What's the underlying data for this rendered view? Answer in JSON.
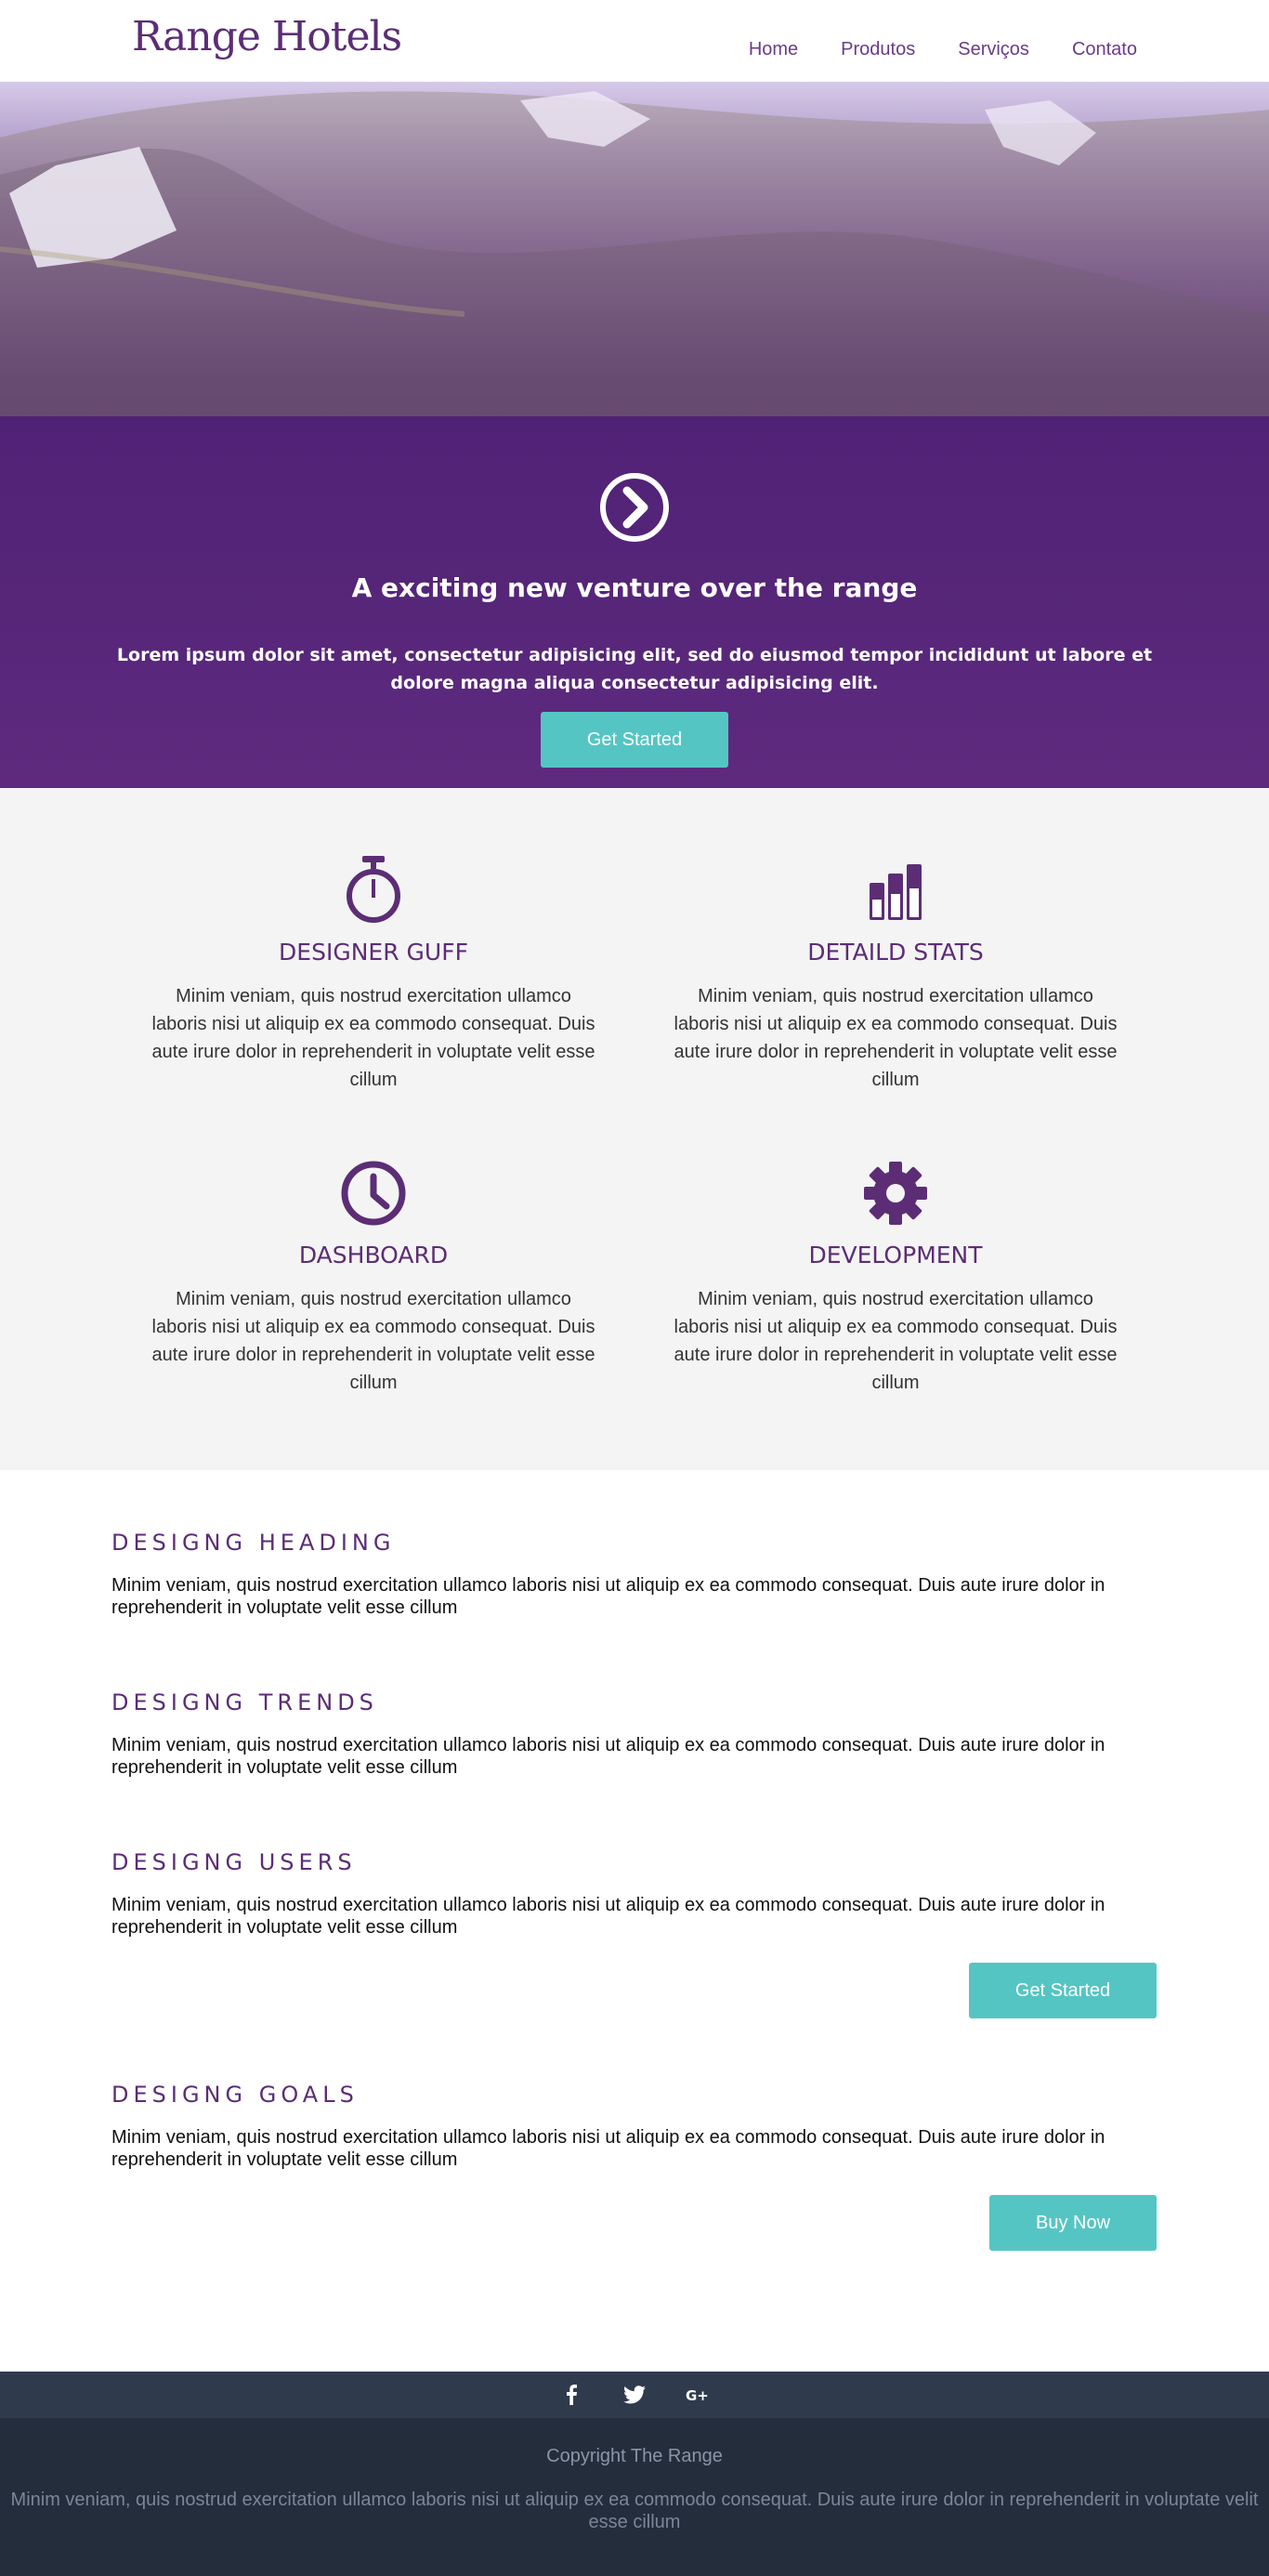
{
  "header": {
    "logo": "Range Hotels",
    "nav": [
      "Home",
      "Produtos",
      "Serviços",
      "Contato"
    ]
  },
  "hero": {
    "icon": "chevron-circle-right-icon",
    "title": "A exciting new venture over the range",
    "text": "Lorem ipsum dolor sit amet, consectetur adipisicing elit, sed do eiusmod tempor incididunt ut labore et dolore magna aliqua consectetur adipisicing elit.",
    "button": "Get Started"
  },
  "features": [
    {
      "icon": "stopwatch-icon",
      "title": "DESIGNER GUFF",
      "text": "Minim veniam, quis nostrud exercitation ullamco laboris nisi ut aliquip ex ea commodo consequat. Duis aute irure dolor in reprehenderit in voluptate velit esse cillum"
    },
    {
      "icon": "bar-chart-icon",
      "title": "DETAILD STATS",
      "text": "Minim veniam, quis nostrud exercitation ullamco laboris nisi ut aliquip ex ea commodo consequat. Duis aute irure dolor in reprehenderit in voluptate velit esse cillum"
    },
    {
      "icon": "clock-icon",
      "title": "DASHBOARD",
      "text": "Minim veniam, quis nostrud exercitation ullamco laboris nisi ut aliquip ex ea commodo consequat. Duis aute irure dolor in reprehenderit in voluptate velit esse cillum"
    },
    {
      "icon": "gear-icon",
      "title": "DEVELOPMENT",
      "text": "Minim veniam, quis nostrud exercitation ullamco laboris nisi ut aliquip ex ea commodo consequat. Duis aute irure dolor in reprehenderit in voluptate velit esse cillum"
    }
  ],
  "sections": [
    {
      "heading": "DESIGNG HEADING",
      "text": "Minim veniam, quis nostrud exercitation ullamco laboris nisi ut aliquip ex ea commodo consequat. Duis aute irure dolor in reprehenderit in voluptate velit esse cillum"
    },
    {
      "heading": "DESIGNG TRENDS",
      "text": "Minim veniam, quis nostrud exercitation ullamco laboris nisi ut aliquip ex ea commodo consequat. Duis aute irure dolor in reprehenderit in voluptate velit esse cillum"
    },
    {
      "heading": "DESIGNG USERS",
      "text": "Minim veniam, quis nostrud exercitation ullamco laboris nisi ut aliquip ex ea commodo consequat. Duis aute irure dolor in reprehenderit in voluptate velit esse cillum",
      "button": "Get Started"
    },
    {
      "heading": "DESIGNG GOALS",
      "text": "Minim veniam, quis nostrud exercitation ullamco laboris nisi ut aliquip ex ea commodo consequat. Duis aute irure dolor in reprehenderit in voluptate velit esse cillum",
      "button": "Buy Now"
    }
  ],
  "social": [
    "facebook-icon",
    "twitter-icon",
    "google-plus-icon"
  ],
  "footer": {
    "copyright": "Copyright The Range",
    "text": "Minim veniam, quis nostrud exercitation ullamco laboris nisi ut aliquip ex ea commodo consequat. Duis aute irure dolor in reprehenderit in voluptate velit esse cillum"
  },
  "colors": {
    "brand_purple": "#5c2d75",
    "accent_teal": "#55c5c4",
    "features_bg": "#f4f4f4",
    "social_bar": "#2f3b4c",
    "footer_bg": "#232d3b"
  }
}
